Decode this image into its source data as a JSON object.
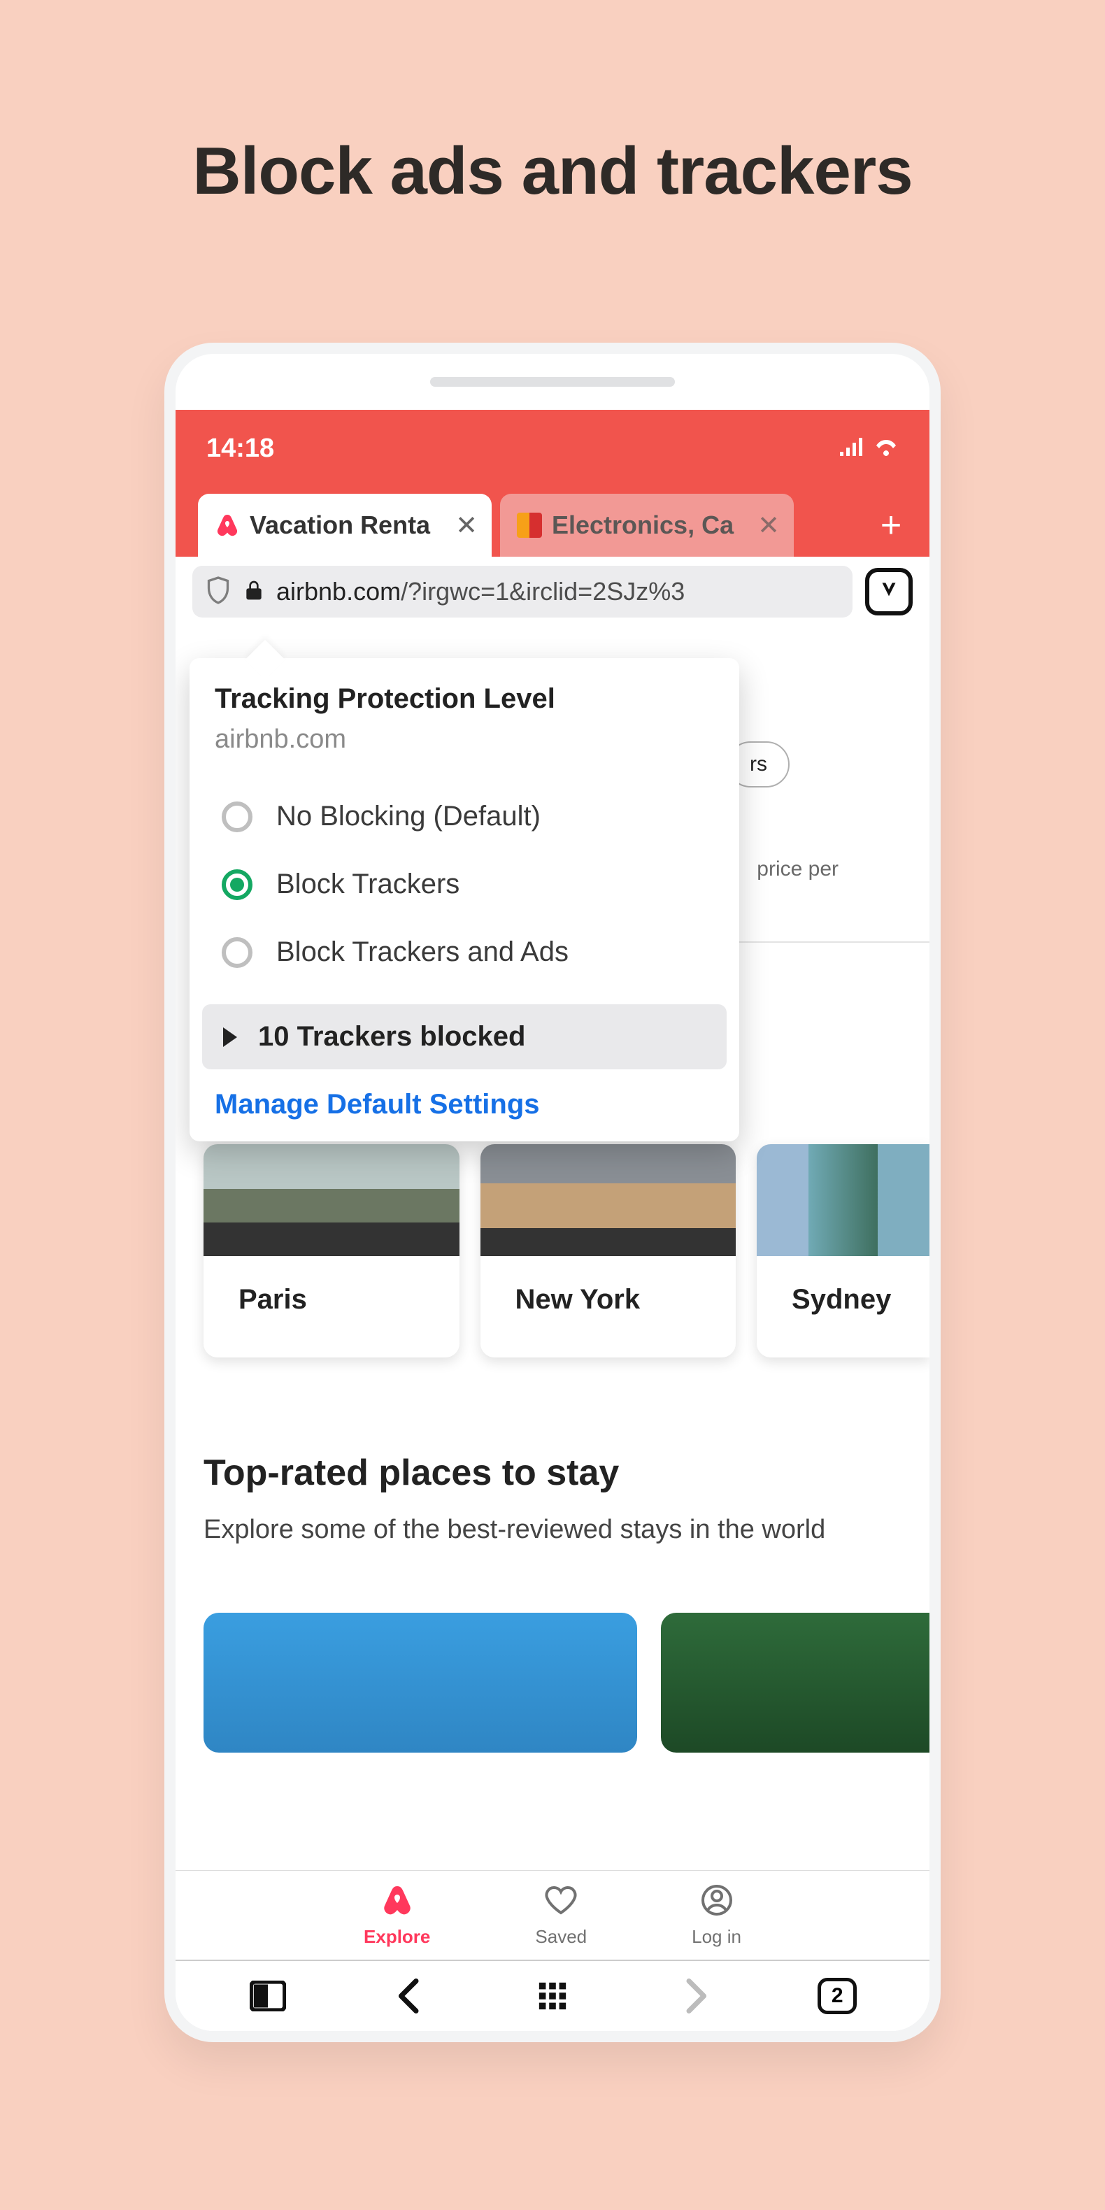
{
  "headline": "Block ads and trackers",
  "status": {
    "time": "14:18"
  },
  "tabs": [
    {
      "label": "Vacation Renta",
      "active": true
    },
    {
      "label": "Electronics, Ca",
      "active": false
    }
  ],
  "address": {
    "domain": "airbnb.com",
    "path": "/?irgwc=1&irclid=2SJz%3"
  },
  "popup": {
    "title": "Tracking Protection Level",
    "domain": "airbnb.com",
    "options": [
      {
        "label": "No Blocking (Default)",
        "checked": false
      },
      {
        "label": "Block Trackers",
        "checked": true
      },
      {
        "label": "Block Trackers and Ads",
        "checked": false
      }
    ],
    "blocked": "10 Trackers blocked",
    "manage": "Manage Default Settings"
  },
  "page": {
    "filter_chip_fragment": "rs",
    "price_fragment": "price per",
    "cities": [
      "Paris",
      "New York",
      "Sydney"
    ],
    "section_title": "Top-rated places to stay",
    "section_body": "Explore some of the best-reviewed stays in the world"
  },
  "bottom_nav": [
    {
      "label": "Explore",
      "active": true
    },
    {
      "label": "Saved",
      "active": false
    },
    {
      "label": "Log in",
      "active": false
    }
  ],
  "browser_bar": {
    "tab_count": "2"
  }
}
